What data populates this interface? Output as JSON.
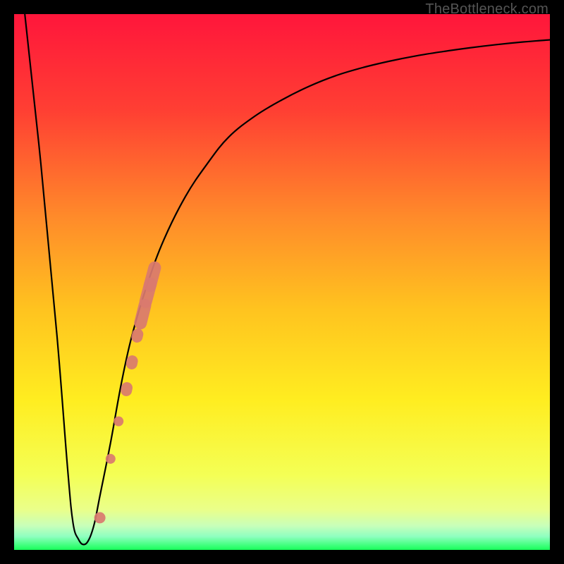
{
  "attribution": "TheBottleneck.com",
  "colors": {
    "top": "#ff1a3a",
    "upper_mid": "#ff7a2a",
    "mid": "#ffd61a",
    "lower_mid": "#f6ff4a",
    "pale": "#dfffb0",
    "green": "#1aff55",
    "curve": "#000000",
    "marker": "#d97a6f",
    "frame": "#000000"
  },
  "chart_data": {
    "type": "line",
    "title": "",
    "xlabel": "",
    "ylabel": "",
    "xlim": [
      0,
      100
    ],
    "ylim": [
      0,
      100
    ],
    "grid": false,
    "series": [
      {
        "name": "bottleneck-curve",
        "x": [
          2,
          5,
          8,
          10,
          11,
          12,
          13,
          14,
          15,
          16,
          18,
          20,
          22,
          25,
          28,
          32,
          36,
          40,
          45,
          50,
          55,
          60,
          65,
          70,
          75,
          80,
          85,
          90,
          95,
          100
        ],
        "y": [
          100,
          72,
          40,
          15,
          5,
          2,
          1,
          2,
          5,
          10,
          20,
          31,
          40,
          50,
          58,
          66,
          72,
          77,
          81,
          84,
          86.5,
          88.5,
          90,
          91.2,
          92.2,
          93,
          93.7,
          94.3,
          94.8,
          95.2
        ]
      }
    ],
    "markers": [
      {
        "x": 16.0,
        "y": 6.0
      },
      {
        "x": 18.0,
        "y": 17.0
      },
      {
        "x": 19.5,
        "y": 24.0
      },
      {
        "x": 21.0,
        "y": 30.0
      },
      {
        "x": 22.0,
        "y": 35.0
      },
      {
        "x": 23.0,
        "y": 40.0
      },
      {
        "x": 24.0,
        "y": 44.0
      },
      {
        "x": 25.0,
        "y": 48.0
      },
      {
        "x": 25.8,
        "y": 51.0
      }
    ]
  }
}
